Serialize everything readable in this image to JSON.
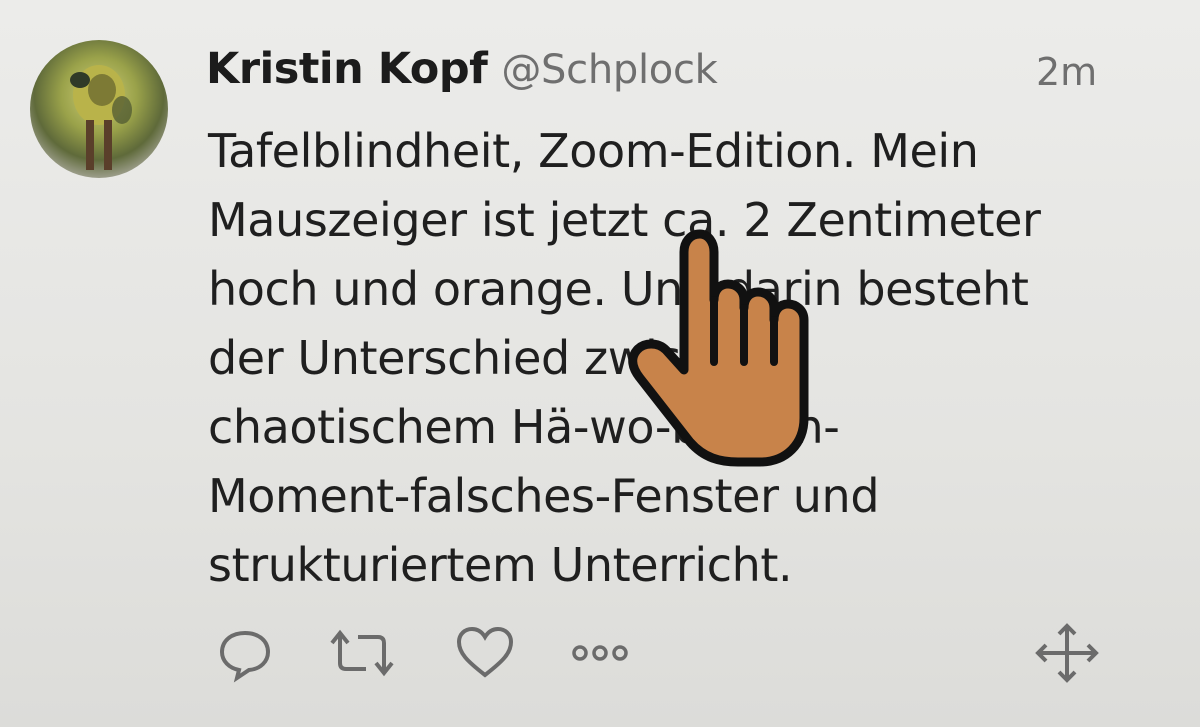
{
  "tweet": {
    "author_name": "Kristin Kopf",
    "author_handle": "@Schplock",
    "timestamp": "2m",
    "text": "Tafelblindheit, Zoom-Edition. Mein\nMauszeiger ist jetzt ca. 2 Zentimeter\nhoch und orange. Und darin besteht\nder Unterschied zwischen\nchaotischem Hä-wo-bin-ich-\nMoment-falsches-Fenster und\nstrukturiertem Unterricht."
  },
  "actions": {
    "reply_icon": "reply-icon",
    "retweet_icon": "retweet-icon",
    "like_icon": "heart-icon",
    "more_icon": "more-icon",
    "move_icon": "move-icon"
  },
  "cursor": {
    "type": "hand-pointer",
    "color": "#c8834a"
  },
  "colors": {
    "name": "#1c1c1c",
    "muted": "#6f6f6f",
    "icon": "#6b6b6b",
    "background": "#e6e6e3"
  }
}
